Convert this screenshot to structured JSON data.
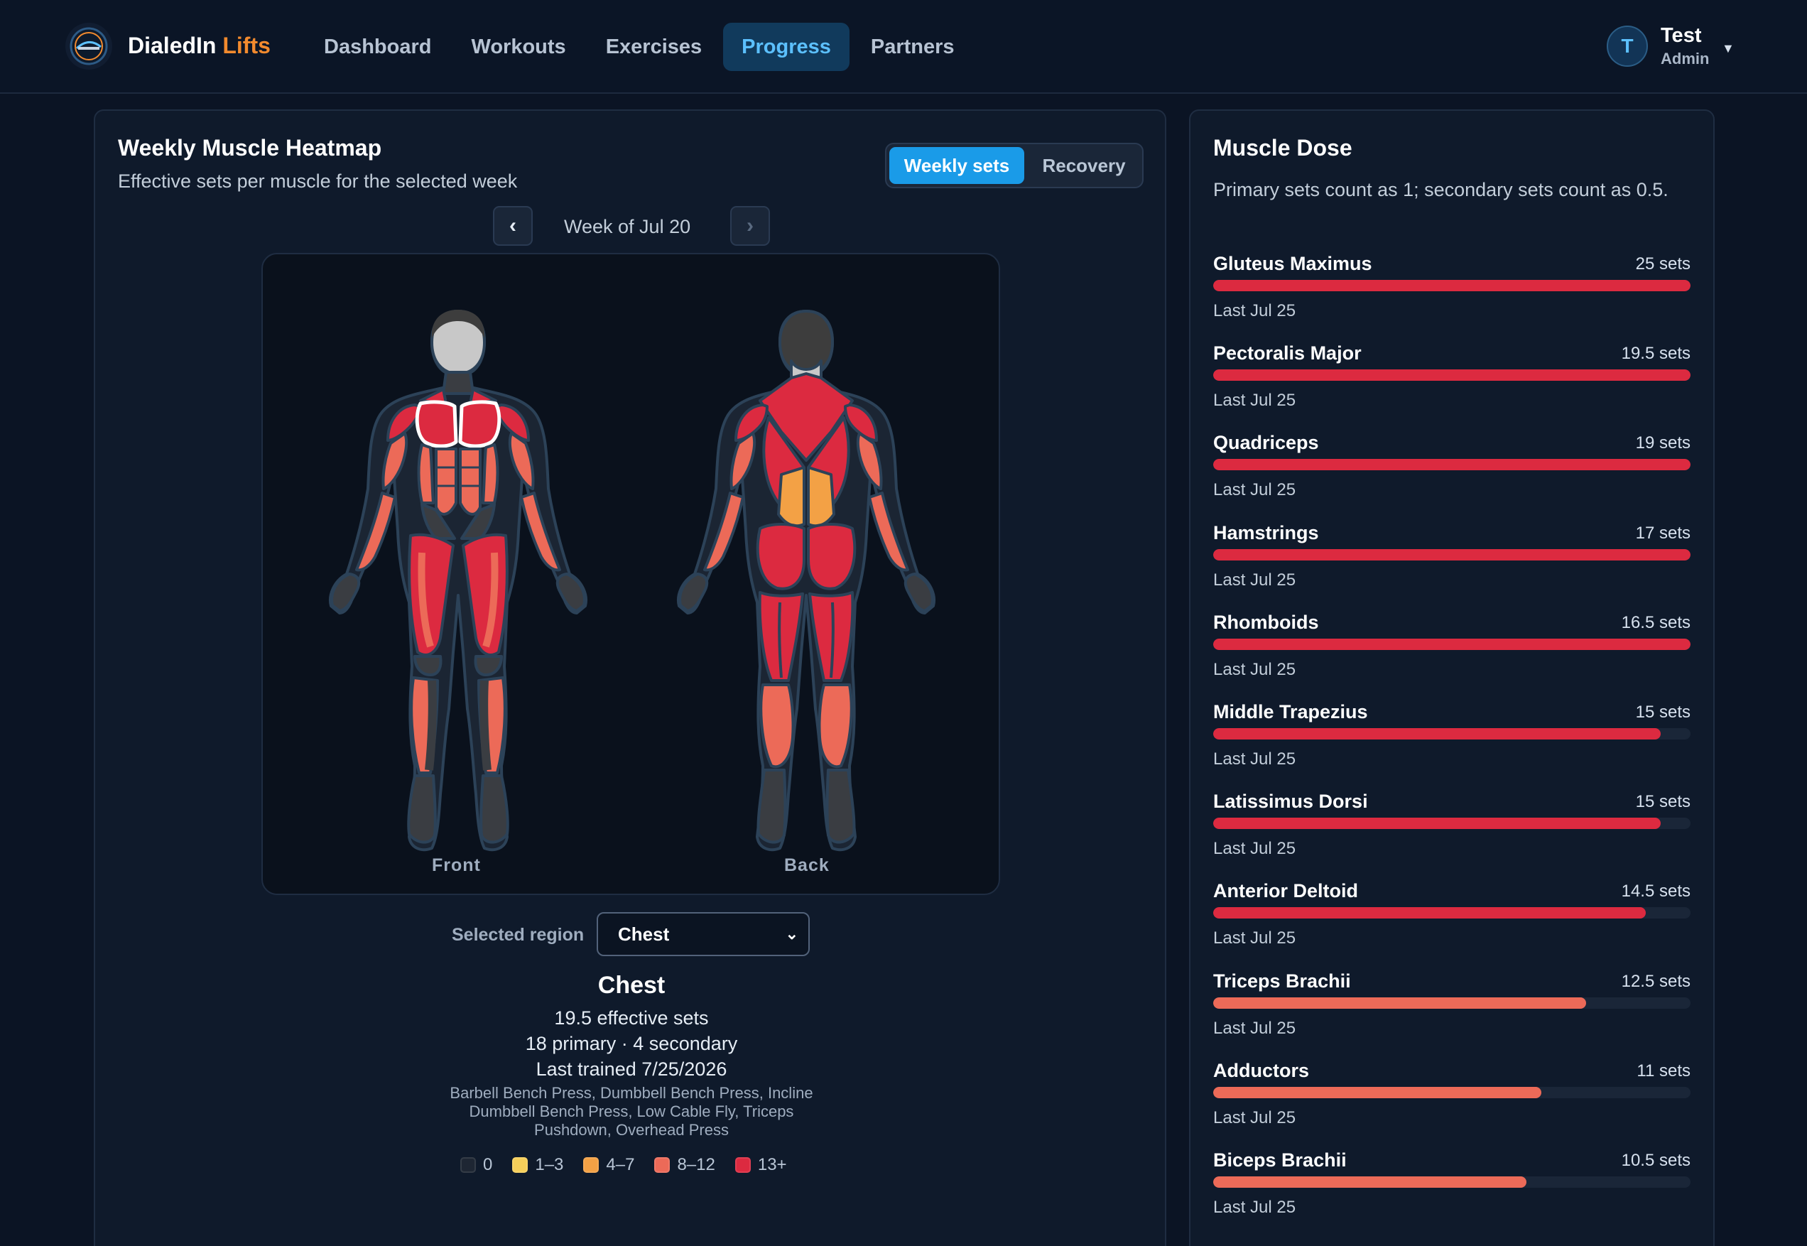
{
  "app": {
    "brand_main": "DialedIn",
    "brand_accent": "Lifts"
  },
  "nav": {
    "items": [
      {
        "label": "Dashboard",
        "active": false
      },
      {
        "label": "Workouts",
        "active": false
      },
      {
        "label": "Exercises",
        "active": false
      },
      {
        "label": "Progress",
        "active": true
      },
      {
        "label": "Partners",
        "active": false
      }
    ]
  },
  "user": {
    "initial": "T",
    "name": "Test",
    "role": "Admin",
    "caret_icon": "caret-down-icon"
  },
  "heatmap": {
    "title": "Weekly Muscle Heatmap",
    "subtitle": "Effective sets per muscle for the selected week",
    "toggle": {
      "weekly_sets": "Weekly sets",
      "recovery": "Recovery",
      "selected": "Weekly sets"
    },
    "week": {
      "prev_icon": "‹",
      "next_icon": "›",
      "label": "Week of Jul 20"
    },
    "views": {
      "front": "Front",
      "back": "Back"
    },
    "region": {
      "label": "Selected region",
      "value": "Chest"
    },
    "detail": {
      "name": "Chest",
      "effective": "19.5 effective sets",
      "split": "18 primary · 4 secondary",
      "last": "Last trained 7/25/2026",
      "exercises": "Barbell Bench Press, Dumbbell Bench Press, Incline Dumbbell Bench Press, Low Cable Fly, Triceps Pushdown, Overhead Press"
    },
    "legend": [
      {
        "label": "0",
        "color": "#1e2633"
      },
      {
        "label": "1–3",
        "color": "#f6cf5a"
      },
      {
        "label": "4–7",
        "color": "#f3a145"
      },
      {
        "label": "8–12",
        "color": "#ec6a58"
      },
      {
        "label": "13+",
        "color": "#dc2a40"
      }
    ],
    "colors": {
      "intense": "#dc2a40",
      "medium": "#ec6a58",
      "moderate": "#f3a145",
      "none": "#3a3d42",
      "outline": "#2c4258"
    }
  },
  "dose": {
    "title": "Muscle Dose",
    "subtitle": "Primary sets count as 1; secondary sets count as 0.5.",
    "max_sets": 16,
    "items": [
      {
        "name": "Gluteus Maximus",
        "sets_label": "25 sets",
        "sets": 25,
        "last": "Last Jul 25",
        "color": "#dc2a40"
      },
      {
        "name": "Pectoralis Major",
        "sets_label": "19.5 sets",
        "sets": 19.5,
        "last": "Last Jul 25",
        "color": "#dc2a40"
      },
      {
        "name": "Quadriceps",
        "sets_label": "19 sets",
        "sets": 19,
        "last": "Last Jul 25",
        "color": "#dc2a40"
      },
      {
        "name": "Hamstrings",
        "sets_label": "17 sets",
        "sets": 17,
        "last": "Last Jul 25",
        "color": "#dc2a40"
      },
      {
        "name": "Rhomboids",
        "sets_label": "16.5 sets",
        "sets": 16.5,
        "last": "Last Jul 25",
        "color": "#dc2a40"
      },
      {
        "name": "Middle Trapezius",
        "sets_label": "15 sets",
        "sets": 15,
        "last": "Last Jul 25",
        "color": "#dc2a40"
      },
      {
        "name": "Latissimus Dorsi",
        "sets_label": "15 sets",
        "sets": 15,
        "last": "Last Jul 25",
        "color": "#dc2a40"
      },
      {
        "name": "Anterior Deltoid",
        "sets_label": "14.5 sets",
        "sets": 14.5,
        "last": "Last Jul 25",
        "color": "#dc2a40"
      },
      {
        "name": "Triceps Brachii",
        "sets_label": "12.5 sets",
        "sets": 12.5,
        "last": "Last Jul 25",
        "color": "#ec6a58"
      },
      {
        "name": "Adductors",
        "sets_label": "11 sets",
        "sets": 11,
        "last": "Last Jul 25",
        "color": "#ec6a58"
      },
      {
        "name": "Biceps Brachii",
        "sets_label": "10.5 sets",
        "sets": 10.5,
        "last": "Last Jul 25",
        "color": "#ec6a58"
      }
    ]
  }
}
